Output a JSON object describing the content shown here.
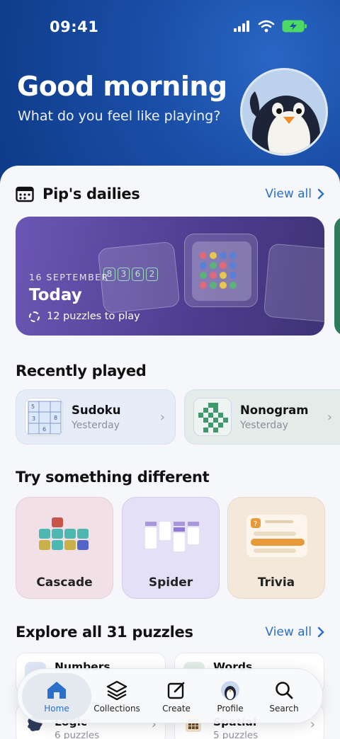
{
  "status": {
    "time": "09:41"
  },
  "hero": {
    "greeting": "Good morning",
    "subtitle": "What do you feel like playing?"
  },
  "dailies": {
    "title": "Pip's dailies",
    "view_all": "View all",
    "card": {
      "date": "16 SEPTEMBER",
      "label": "Today",
      "count": "12 puzzles to play",
      "digits": [
        "8",
        "3",
        "6",
        "2"
      ]
    }
  },
  "recent": {
    "title": "Recently played",
    "items": [
      {
        "name": "Sudoku",
        "when": "Yesterday"
      },
      {
        "name": "Nonogram",
        "when": "Yesterday"
      }
    ],
    "sudoku_digits": [
      "5",
      "8",
      "3",
      "6"
    ]
  },
  "try": {
    "title": "Try something different",
    "items": [
      {
        "name": "Cascade",
        "bg": "#f1e0e6"
      },
      {
        "name": "Spider",
        "bg": "#e4e0f5"
      },
      {
        "name": "Trivia",
        "bg": "#f4e8da"
      }
    ]
  },
  "explore": {
    "title": "Explore all 31 puzzles",
    "view_all": "View all",
    "items": [
      {
        "name": "Numbers"
      },
      {
        "name": "Words"
      },
      {
        "name": "Logic",
        "count": "6 puzzles"
      },
      {
        "name": "Spatial",
        "count": "5 puzzles"
      }
    ]
  },
  "tabs": [
    {
      "label": "Home",
      "icon": "home-icon",
      "active": true
    },
    {
      "label": "Collections",
      "icon": "layers-icon"
    },
    {
      "label": "Create",
      "icon": "edit-icon"
    },
    {
      "label": "Profile",
      "icon": "penguin-icon"
    },
    {
      "label": "Search",
      "icon": "search-icon"
    }
  ],
  "colors": {
    "accent": "#2a6fc9",
    "hero_bg": "#1a4fa8",
    "daily_bg": "#5a48a0"
  }
}
